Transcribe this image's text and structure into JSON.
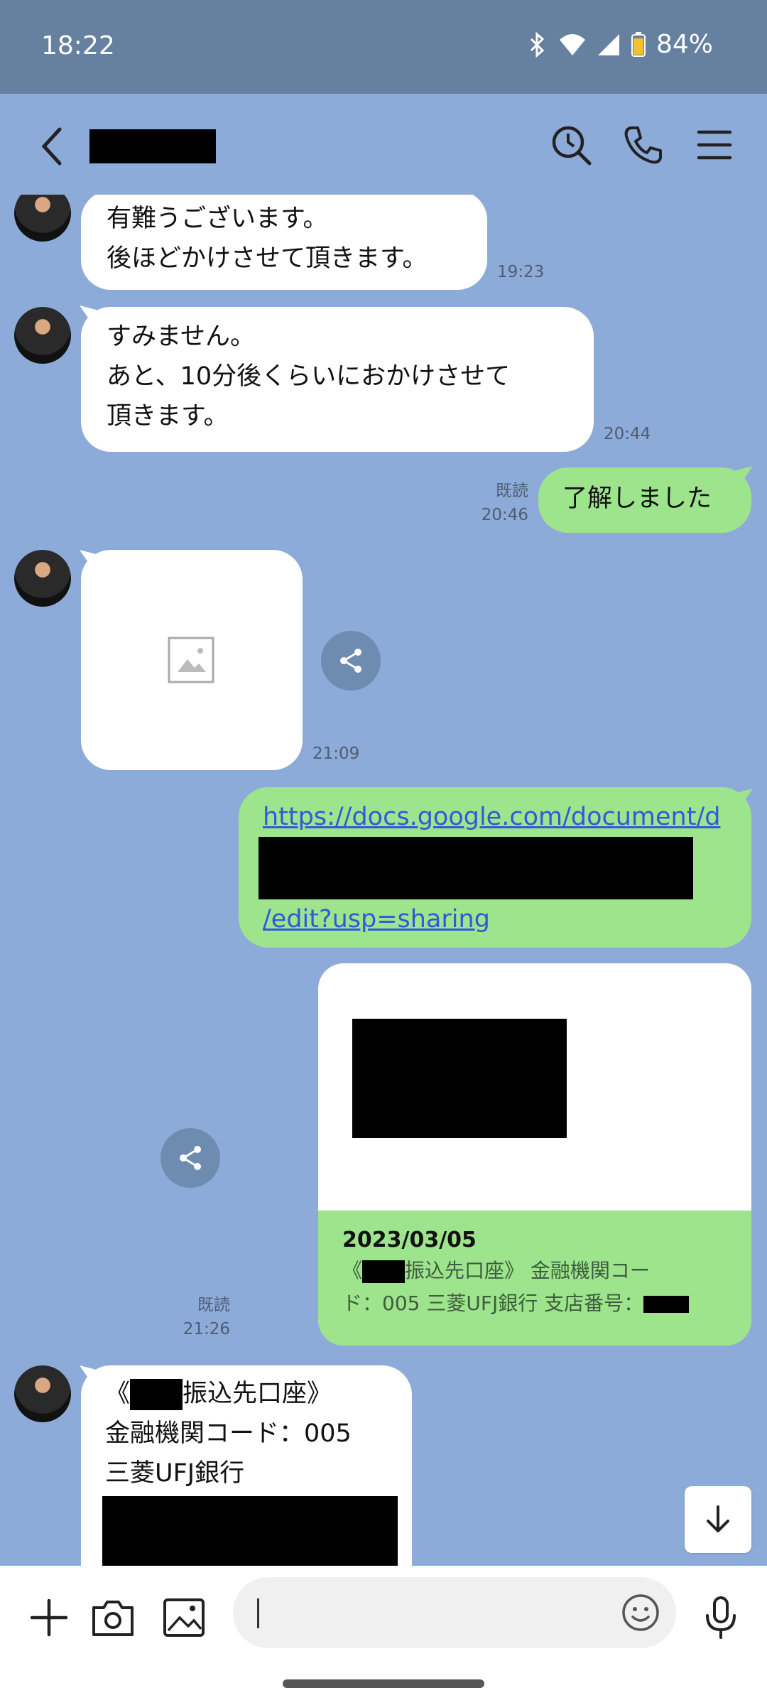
{
  "status": {
    "time": "18:22",
    "battery": "84%"
  },
  "messages": {
    "m1": {
      "lines": [
        "有難うございます。",
        "後ほどかけさせて頂きます。"
      ],
      "time": "19:23"
    },
    "m2": {
      "lines": [
        "すみません。",
        "あと、10分後くらいにおかけさせて",
        "頂きます。"
      ],
      "time": "20:44"
    },
    "m3": {
      "text": "了解しました",
      "read": "既読",
      "time": "20:46"
    },
    "m4": {
      "time": "21:09"
    },
    "m5": {
      "link_top": "https://docs.google.com/document/d",
      "link_bottom": "/edit?usp=sharing"
    },
    "m6": {
      "date": "2023/03/05",
      "desc_line1_pre": "《",
      "desc_line1_post": "振込先口座》 金融機関コー",
      "desc_line2": "ド：005 三菱UFJ銀行 支店番号：",
      "read": "既読",
      "time": "21:26"
    },
    "m7": {
      "line1_pre": "《",
      "line1_post": "振込先口座》",
      "line2": "金融機関コード：005",
      "line3": "三菱UFJ銀行"
    }
  },
  "colors": {
    "chat_bg": "#8dabd9",
    "own_bubble": "#9de48d",
    "status_bar": "#66809f"
  }
}
